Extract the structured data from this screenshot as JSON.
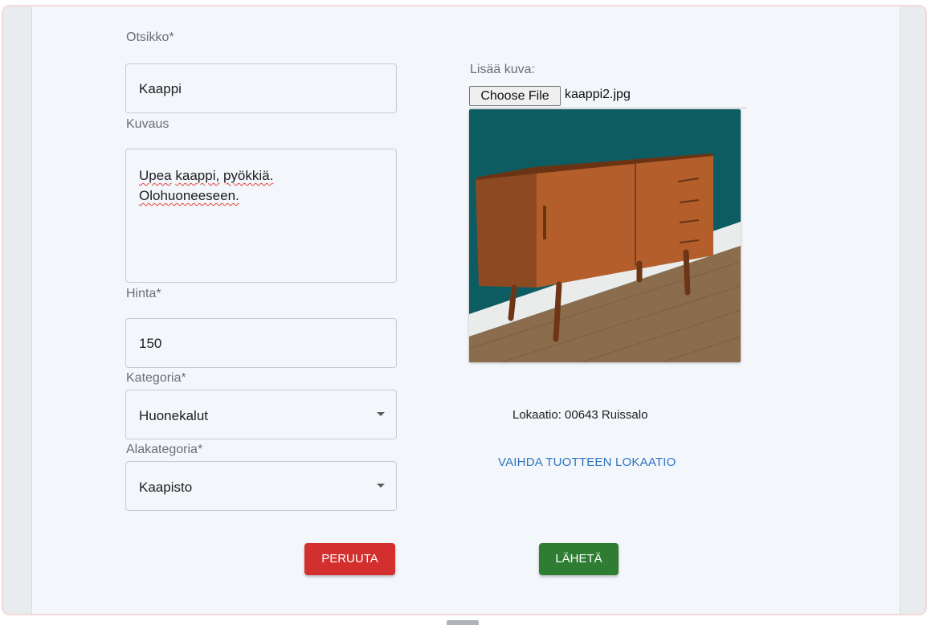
{
  "form": {
    "title_label": "Otsikko*",
    "title_value": "Kaappi",
    "description_label": "Kuvaus",
    "description_line1_word1": "Upea",
    "description_line1_word2": "kaappi,",
    "description_line1_word3": "pyökkiä.",
    "description_line2": "Olohuoneeseen.",
    "price_label": "Hinta*",
    "price_value": "150",
    "category_label": "Kategoria*",
    "category_value": "Huonekalut",
    "subcategory_label": "Alakategoria*",
    "subcategory_value": "Kaapisto"
  },
  "image": {
    "label": "Lisää kuva:",
    "choose_button": "Choose File",
    "file_name": "kaappi2.jpg"
  },
  "location": {
    "text": "Lokaatio: 00643 Ruissalo",
    "change_link": "VAIHDA TUOTTEEN LOKAATIO"
  },
  "actions": {
    "cancel_label": "PERUUTA",
    "submit_label": "LÄHETÄ"
  },
  "colors": {
    "cancel": "#d32f2f",
    "submit": "#2e7d32",
    "link": "#2f74c0"
  }
}
